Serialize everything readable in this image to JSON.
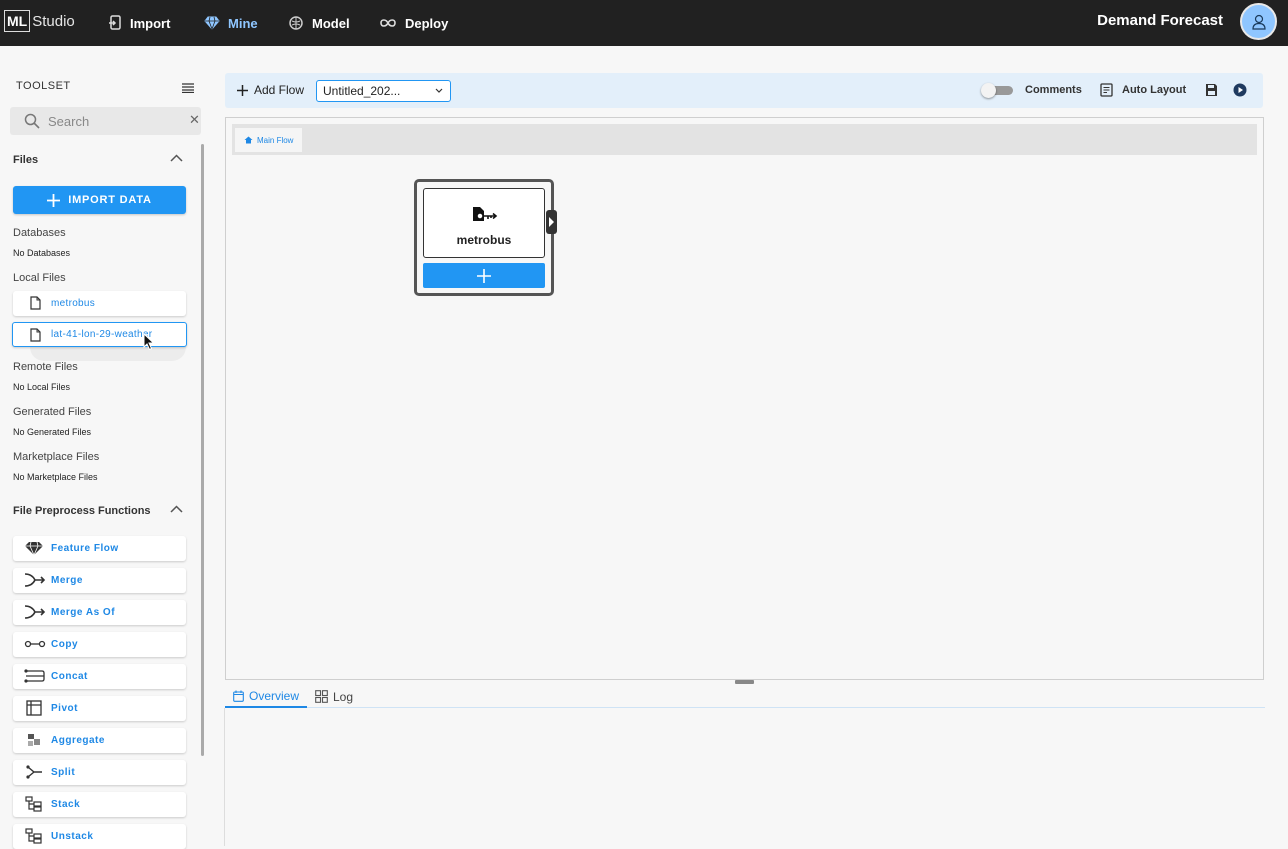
{
  "app": {
    "logo_box": "ML",
    "logo_text": "Studio",
    "project_title": "Demand Forecast"
  },
  "nav": [
    {
      "label": "Import",
      "icon": "import-icon",
      "active": false
    },
    {
      "label": "Mine",
      "icon": "diamond-icon",
      "active": true
    },
    {
      "label": "Model",
      "icon": "brain-icon",
      "active": false
    },
    {
      "label": "Deploy",
      "icon": "infinity-icon",
      "active": false
    }
  ],
  "sidebar": {
    "title": "TOOLSET",
    "search": {
      "placeholder": "Search",
      "value": ""
    },
    "files_header": "Files",
    "import_button": "IMPORT DATA",
    "databases": {
      "label": "Databases",
      "empty": "No Databases"
    },
    "local_files": {
      "label": "Local Files",
      "items": [
        "metrobus",
        "lat-41-lon-29-weather"
      ]
    },
    "remote_files": {
      "label": "Remote Files",
      "empty": "No Local Files"
    },
    "generated_files": {
      "label": "Generated Files",
      "empty": "No Generated Files"
    },
    "marketplace_files": {
      "label": "Marketplace Files",
      "empty": "No Marketplace Files"
    },
    "preprocess_header": "File Preprocess Functions",
    "functions": [
      {
        "label": "Feature Flow",
        "icon": "feature-flow-icon"
      },
      {
        "label": "Merge",
        "icon": "merge-icon"
      },
      {
        "label": "Merge As Of",
        "icon": "merge-as-of-icon"
      },
      {
        "label": "Copy",
        "icon": "copy-icon"
      },
      {
        "label": "Concat",
        "icon": "concat-icon"
      },
      {
        "label": "Pivot",
        "icon": "pivot-icon"
      },
      {
        "label": "Aggregate",
        "icon": "aggregate-icon"
      },
      {
        "label": "Split",
        "icon": "split-icon"
      },
      {
        "label": "Stack",
        "icon": "stack-icon"
      },
      {
        "label": "Unstack",
        "icon": "unstack-icon"
      }
    ]
  },
  "toolbar": {
    "add_flow": "Add Flow",
    "flow_select": "Untitled_202...",
    "comments": "Comments",
    "comments_enabled": false,
    "auto_layout": "Auto Layout"
  },
  "canvas": {
    "breadcrumb": "Main Flow",
    "node": {
      "label": "metrobus",
      "icon": "file-key-icon"
    }
  },
  "bottom_tabs": [
    {
      "label": "Overview",
      "active": true
    },
    {
      "label": "Log",
      "active": false
    }
  ],
  "colors": {
    "accent": "#2196f3",
    "topbar": "#212121",
    "active_nav": "#8fc6ff",
    "toolbar_bg": "#e3effa"
  }
}
